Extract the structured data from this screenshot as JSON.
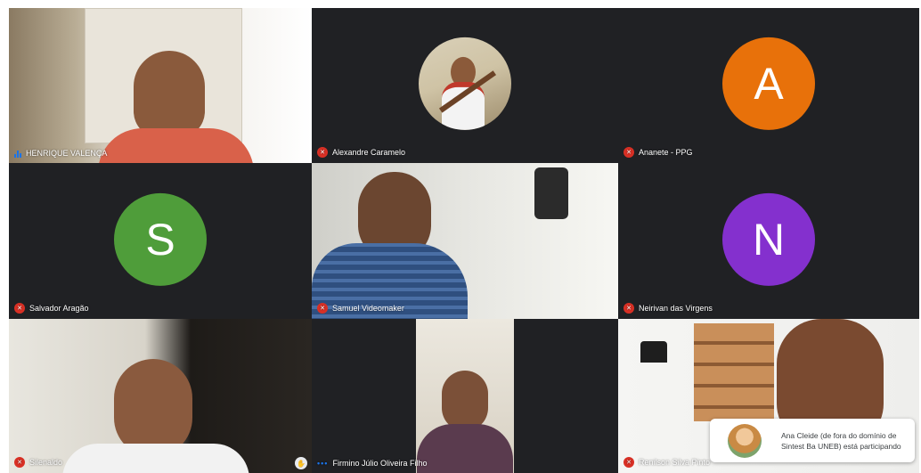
{
  "participants": [
    {
      "name": "HENRIQUE VALENÇA",
      "status": "speaking"
    },
    {
      "name": "Alexandre Caramelo",
      "status": "muted"
    },
    {
      "name": "Ananete - PPG",
      "status": "muted",
      "initial": "A",
      "color": "#e8710a"
    },
    {
      "name": "Salvador Aragão",
      "status": "muted",
      "initial": "S",
      "color": "#4f9d3a"
    },
    {
      "name": "Samuel Videomaker",
      "status": "muted"
    },
    {
      "name": "Neirivan das Virgens",
      "status": "muted",
      "initial": "N",
      "color": "#8430ce"
    },
    {
      "name": "Silenaldo",
      "status": "muted"
    },
    {
      "name": "Firmino Júlio Oliveira Filho",
      "status": "active"
    },
    {
      "name": "Renilson Silva Pinto",
      "status": "muted"
    }
  ],
  "notification": {
    "text": "Ana Cleide (de fora do domínio de Sintest Ba UNEB) está participando"
  },
  "icons": {
    "muted": "mic-off-icon",
    "speaking": "audio-level-icon",
    "active": "audio-dots-icon",
    "raise": "hand-icon"
  }
}
